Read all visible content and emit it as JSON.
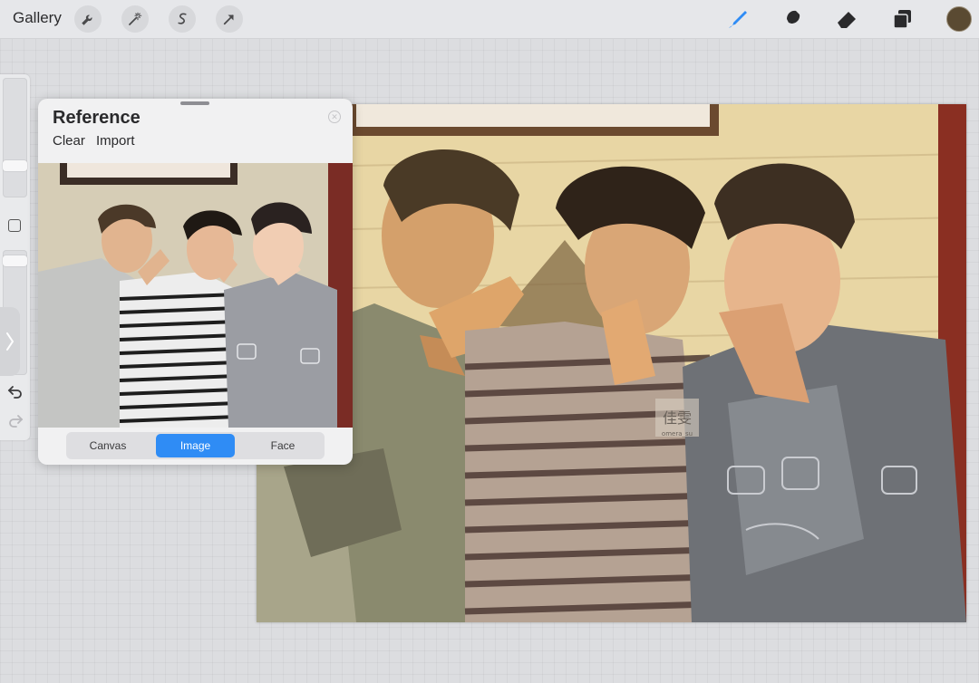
{
  "topbar": {
    "gallery_label": "Gallery",
    "left_tools": [
      "wrench-icon",
      "magic-wand-icon",
      "selection-icon",
      "transform-arrow-icon"
    ],
    "right_tools": [
      "brush-icon",
      "smudge-icon",
      "eraser-icon",
      "layers-icon"
    ],
    "color_current": "#5a4a32",
    "accent": "#2f8cf5"
  },
  "sidebar": {
    "icons": [
      "brush-size-slider",
      "modify-square-icon",
      "opacity-slider",
      "sidebar-toggle-chevron-icon",
      "undo-icon",
      "redo-icon"
    ]
  },
  "reference": {
    "title": "Reference",
    "clear_label": "Clear",
    "import_label": "Import",
    "tabs": [
      {
        "label": "Canvas",
        "active": false
      },
      {
        "label": "Image",
        "active": true
      },
      {
        "label": "Face",
        "active": false
      }
    ]
  },
  "canvas": {
    "signature": "佳雯",
    "signature_handle": "omera_su"
  }
}
